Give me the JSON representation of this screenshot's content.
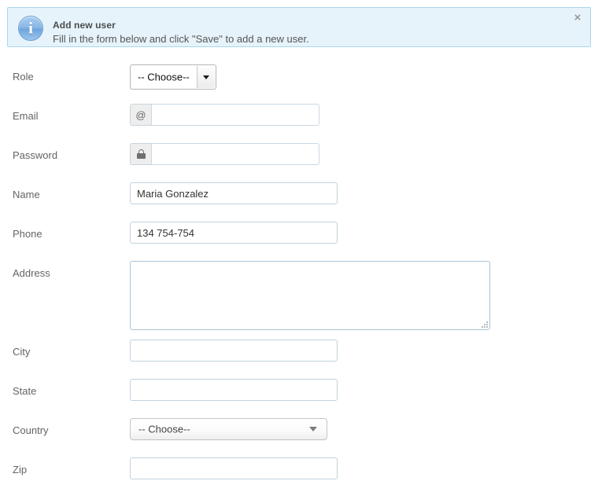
{
  "alert": {
    "icon": "info-circle-icon",
    "icon_glyph": "i",
    "title": "Add new user",
    "message": "Fill in the form below and click \"Save\" to add a new user.",
    "close_label": "×",
    "background": "#e6f3fb",
    "border_color": "#a9d6ea"
  },
  "form": {
    "fields": [
      {
        "label": "Role",
        "type": "select-native",
        "value": "-- Choose--",
        "placeholder": "",
        "name": "role"
      },
      {
        "label": "Email",
        "type": "input-addon",
        "addon": "@",
        "addon_icon": "at-sign-icon",
        "value": "",
        "placeholder": "",
        "name": "email"
      },
      {
        "label": "Password",
        "type": "input-addon",
        "addon": "",
        "addon_icon": "lock-icon",
        "value": "",
        "placeholder": "",
        "name": "password"
      },
      {
        "label": "Name",
        "type": "text",
        "value": "Maria Gonzalez",
        "placeholder": "",
        "name": "name"
      },
      {
        "label": "Phone",
        "type": "text",
        "value": "134 754-754",
        "placeholder": "",
        "name": "phone"
      },
      {
        "label": "Address",
        "type": "textarea",
        "value": "",
        "placeholder": "",
        "name": "address"
      },
      {
        "label": "City",
        "type": "text",
        "value": "",
        "placeholder": "",
        "name": "city"
      },
      {
        "label": "State",
        "type": "text",
        "value": "",
        "placeholder": "",
        "name": "state"
      },
      {
        "label": "Country",
        "type": "select-styled",
        "value": "-- Choose--",
        "placeholder": "",
        "name": "country"
      },
      {
        "label": "Zip",
        "type": "text",
        "value": "",
        "placeholder": "",
        "name": "zip"
      }
    ]
  }
}
